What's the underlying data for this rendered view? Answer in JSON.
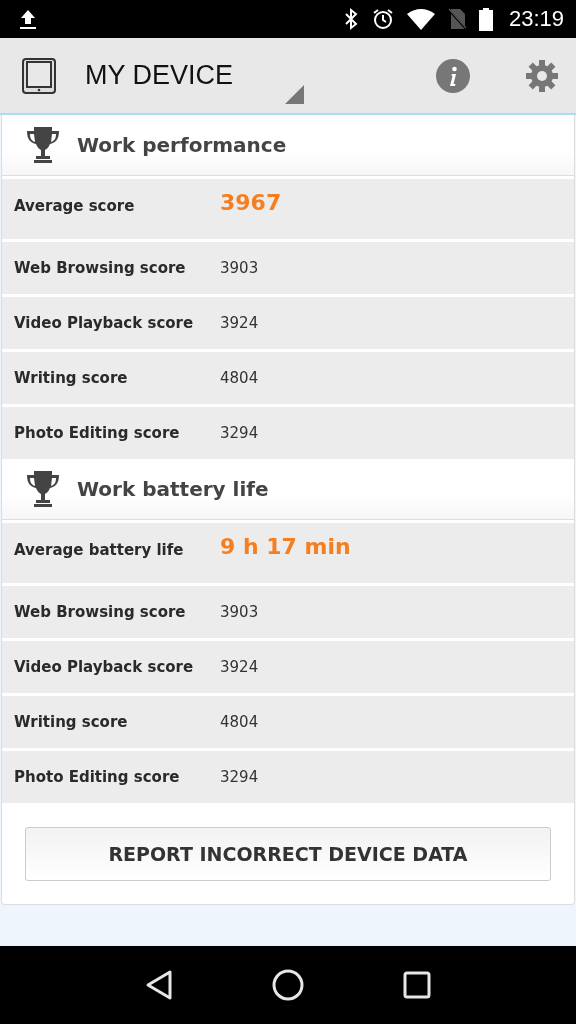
{
  "status_bar": {
    "time": "23:19"
  },
  "app_bar": {
    "title": "MY DEVICE"
  },
  "sections": [
    {
      "title": "Work performance",
      "rows": [
        {
          "kind": "average",
          "label": "Average score",
          "value": "3967"
        },
        {
          "kind": "score",
          "label": "Web Browsing score",
          "value": "3903"
        },
        {
          "kind": "score",
          "label": "Video Playback score",
          "value": "3924"
        },
        {
          "kind": "score",
          "label": "Writing score",
          "value": "4804"
        },
        {
          "kind": "score",
          "label": "Photo Editing score",
          "value": "3294"
        }
      ]
    },
    {
      "title": "Work battery life",
      "rows": [
        {
          "kind": "average",
          "label": "Average battery life",
          "value": "9 h 17 min"
        },
        {
          "kind": "score",
          "label": "Web Browsing score",
          "value": "3903"
        },
        {
          "kind": "score",
          "label": "Video Playback score",
          "value": "3924"
        },
        {
          "kind": "score",
          "label": "Writing score",
          "value": "4804"
        },
        {
          "kind": "score",
          "label": "Photo Editing score",
          "value": "3294"
        }
      ]
    }
  ],
  "report_button": "REPORT INCORRECT DEVICE DATA"
}
